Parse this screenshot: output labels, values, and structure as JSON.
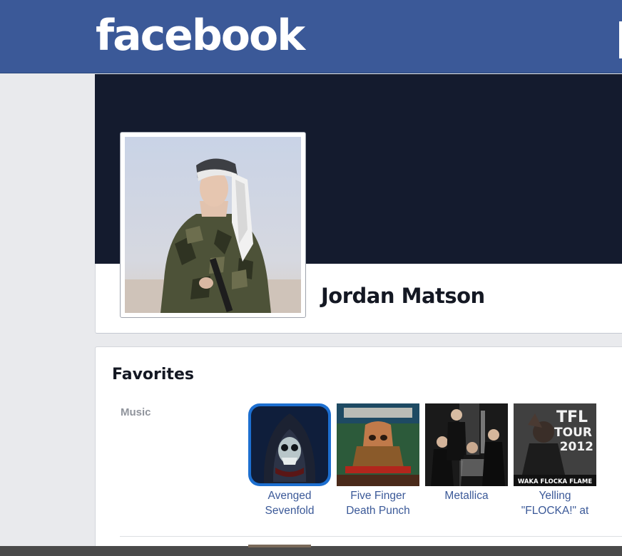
{
  "header": {
    "logo_text": "facebook",
    "brand_color": "#3b5998"
  },
  "profile": {
    "name": "Jordan Matson",
    "cover_color": "#141b2e"
  },
  "favorites": {
    "title": "Favorites",
    "music_label": "Music",
    "items": [
      {
        "line1": "Avenged",
        "line2": "Sevenfold",
        "icon": "avenged-sevenfold-deathbat-art"
      },
      {
        "line1": "Five Finger",
        "line2": "Death Punch",
        "icon": "five-finger-death-punch-album-art"
      },
      {
        "line1": "Metallica",
        "line2": "",
        "icon": "metallica-band-photo"
      },
      {
        "line1": "Yelling",
        "line2": "\"FLOCKA!\" at",
        "icon": "waka-flocka-flame-tour-poster"
      }
    ],
    "poster_text": {
      "tfl": "TFL",
      "tour": "TOUR",
      "year": "2012",
      "artist": "WAKA FLOCKA FLAME"
    }
  }
}
